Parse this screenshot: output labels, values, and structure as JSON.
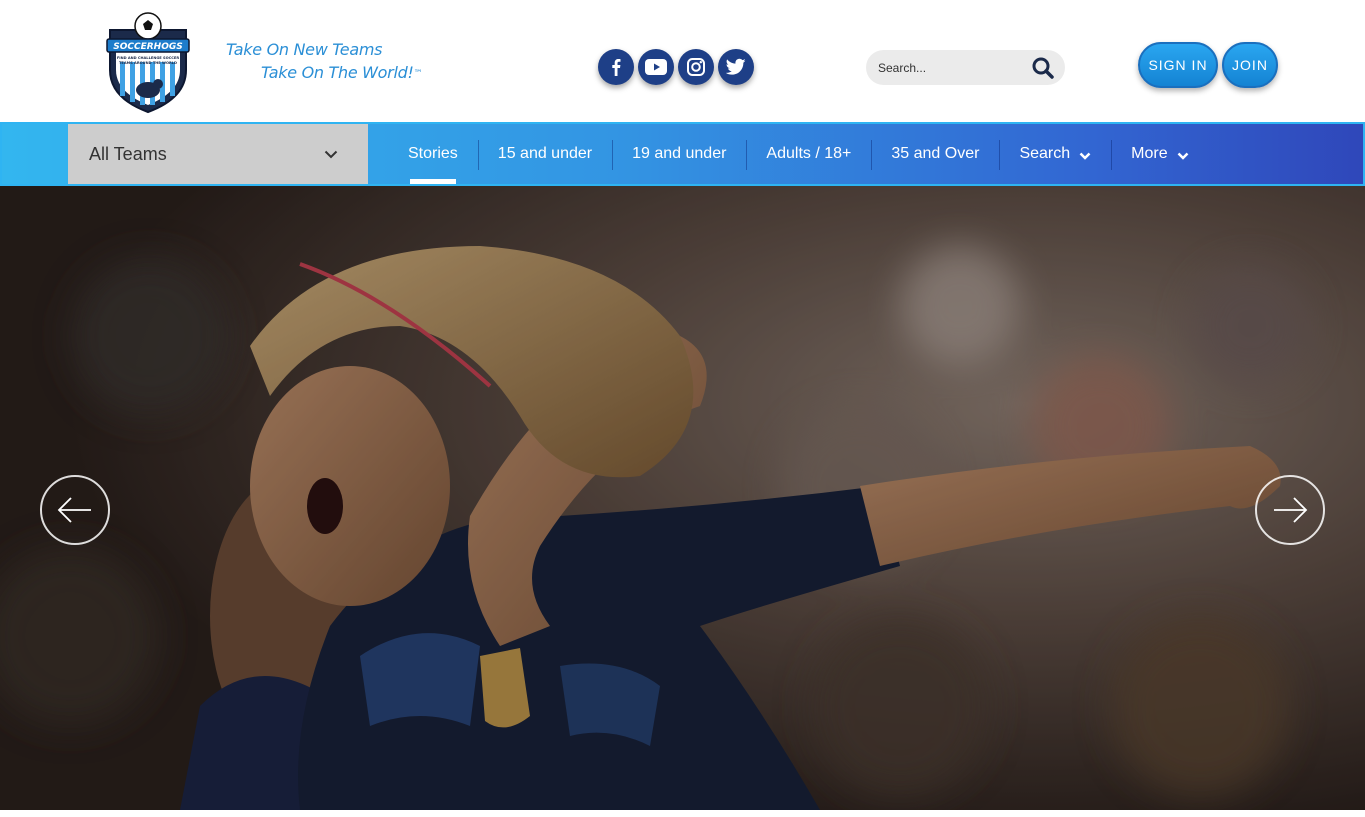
{
  "header": {
    "logo": {
      "alt": "SoccerHogs",
      "icon": "soccerhogs-shield-logo",
      "text": "SOCCERHOGS",
      "subtext": "FIND AND CHALLENGE SOCCER TEAMS AROUND THE WORLD"
    },
    "tagline": {
      "line1": "Take On New Teams",
      "line2": "Take On The World!",
      "trademark": "™"
    },
    "social": [
      {
        "name": "facebook",
        "icon": "facebook-icon"
      },
      {
        "name": "youtube",
        "icon": "youtube-icon"
      },
      {
        "name": "instagram",
        "icon": "instagram-icon"
      },
      {
        "name": "twitter",
        "icon": "twitter-icon"
      }
    ],
    "search": {
      "placeholder": "Search...",
      "icon": "search-icon"
    },
    "signin_label": "SIGN IN",
    "join_label": "JOIN"
  },
  "nav": {
    "team_select": {
      "value": "All Teams"
    },
    "items": [
      {
        "label": "Stories",
        "active": true
      },
      {
        "label": "15 and under"
      },
      {
        "label": "19 and under"
      },
      {
        "label": "Adults / 18+"
      },
      {
        "label": "35 and Over"
      },
      {
        "label": "Search",
        "dropdown": true
      },
      {
        "label": "More",
        "dropdown": true
      }
    ]
  },
  "hero": {
    "alt": "Soccer players celebrating",
    "prev_icon": "arrow-left-icon",
    "next_icon": "arrow-right-icon"
  },
  "colors": {
    "brand_blue": "#2b8fd6",
    "social_navy": "#1e3f87",
    "nav_start": "#33b6ef",
    "nav_end": "#2f47ba",
    "button_blue": "#1a8ee0"
  }
}
